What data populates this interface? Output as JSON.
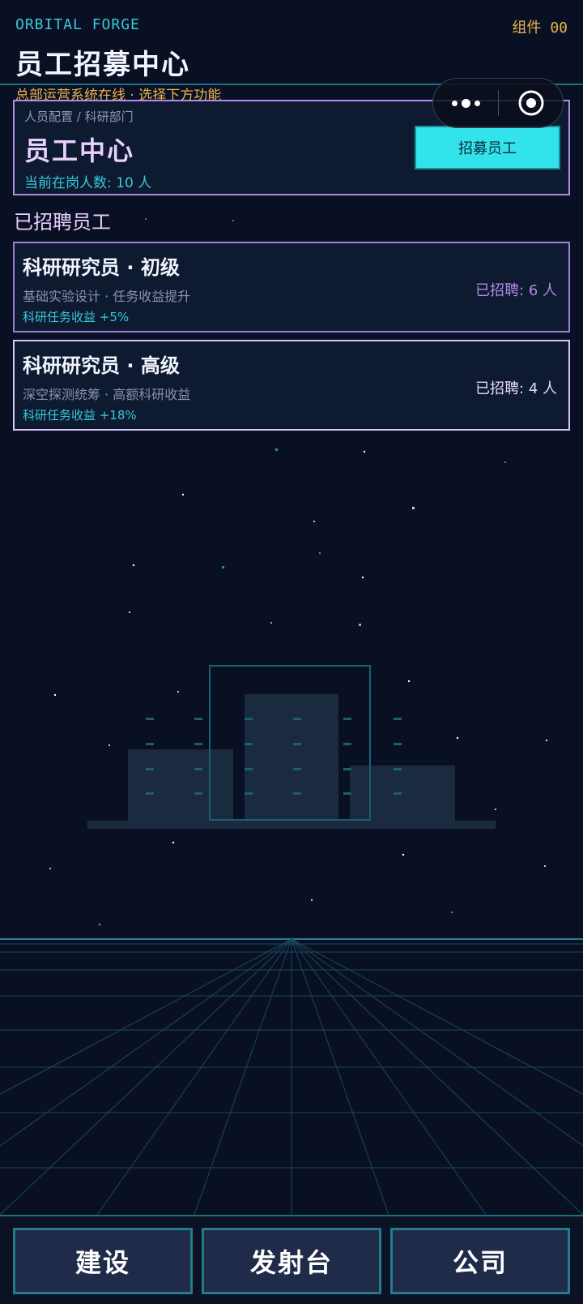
{
  "header": {
    "brand": "ORBITAL FORGE",
    "counter": "组件 00",
    "title": "员工招募中心",
    "status": "总部运营系统在线 · 选择下方功能"
  },
  "capsule": {
    "more_icon": "more-dots-icon",
    "close_icon": "target-circle-icon"
  },
  "center_card": {
    "breadcrumb": "人员配置 / 科研部门",
    "title": "员工中心",
    "headcount": "当前在岗人数: 10 人",
    "recruit_label": "招募员工"
  },
  "section_title": "已招聘员工",
  "staff": [
    {
      "name": "科研研究员 · 初级",
      "desc": "基础实验设计 · 任务收益提升",
      "bonus": "科研任务收益 +5%",
      "count": "已招聘: 6 人"
    },
    {
      "name": "科研研究员 · 高级",
      "desc": "深空探测统筹 · 高额科研收益",
      "bonus": "科研任务收益 +18%",
      "count": "已招聘: 4 人"
    }
  ],
  "bottom_nav": {
    "build_label": "建设",
    "launchpad_label": "发射台",
    "company_label": "公司"
  },
  "colors": {
    "background": "#0a1023",
    "accent_cyan": "#37c9d9",
    "accent_gold": "#e9b44c",
    "accent_purple": "#b28ae6",
    "button_cyan": "#33e3ec"
  }
}
